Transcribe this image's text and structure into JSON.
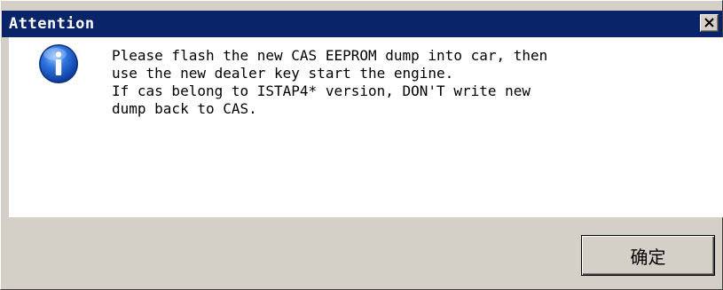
{
  "window": {
    "title": "Attention",
    "close_icon": "close-icon"
  },
  "message": {
    "icon": "info-icon",
    "lines": [
      "Please flash the new CAS EEPROM dump into car, then",
      "use the new dealer key start the engine.",
      "If cas belong to ISTAP4* version, DON'T write new",
      "dump back to CAS."
    ]
  },
  "buttons": {
    "ok_label": "确定"
  },
  "colors": {
    "title_bar": "#0a246a",
    "dialog_face": "#d4d0c8",
    "content_bg": "#ffffff",
    "icon_blue": "#1b5bc4"
  }
}
